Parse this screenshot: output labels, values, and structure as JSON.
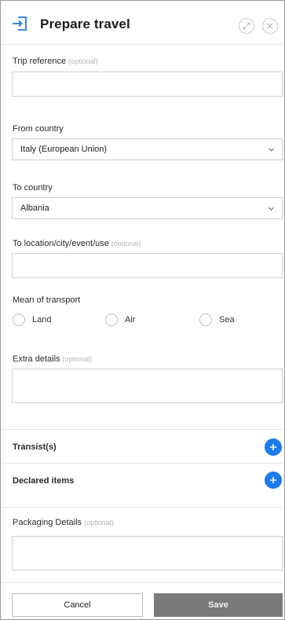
{
  "header": {
    "title": "Prepare travel",
    "icon": "enter-icon",
    "accent_color": "#1f7be8"
  },
  "fields": {
    "trip_reference": {
      "label": "Trip reference",
      "optional": "(optional)",
      "value": ""
    },
    "from_country": {
      "label": "From country",
      "value": "Italy (European Union)"
    },
    "to_country": {
      "label": "To country",
      "value": "Albania"
    },
    "to_location": {
      "label": "To location/city/event/use",
      "optional": "(optional)",
      "value": ""
    },
    "transport": {
      "label": "Mean of transport",
      "options": [
        "Land",
        "Air",
        "Sea"
      ]
    },
    "extra_details": {
      "label": "Extra details",
      "optional": "(optional)",
      "value": ""
    },
    "transits": {
      "label": "Transist(s)"
    },
    "declared_items": {
      "label": "Declared items"
    },
    "packaging_details": {
      "label": "Packaging Details",
      "optional": "(optional)",
      "value": ""
    }
  },
  "footer": {
    "cancel_label": "Cancel",
    "save_label": "Save",
    "save_color": "#7a7a7a"
  }
}
